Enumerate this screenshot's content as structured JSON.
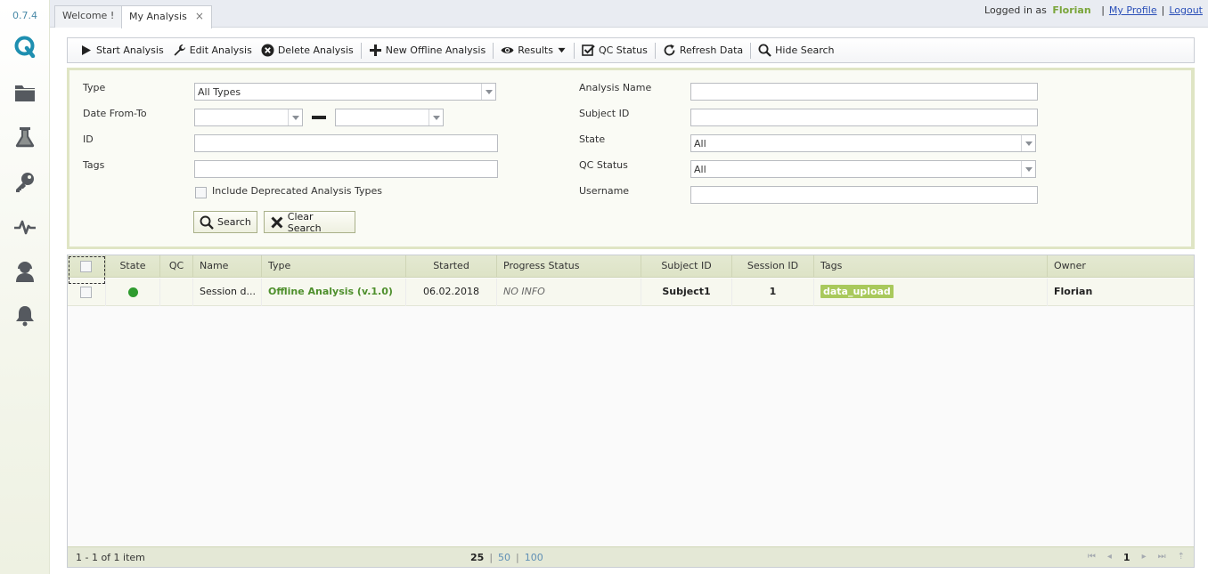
{
  "app": {
    "version": "0.7.4",
    "brand_color": "#1e8fb0",
    "accent_color": "#7aa53a"
  },
  "sidebar": {
    "items": [
      {
        "name": "logo-q-icon"
      },
      {
        "name": "folder-icon"
      },
      {
        "name": "flask-icon"
      },
      {
        "name": "key-icon"
      },
      {
        "name": "heartbeat-icon"
      },
      {
        "name": "user-support-icon"
      },
      {
        "name": "bell-icon"
      }
    ]
  },
  "tabs": [
    {
      "label": "Welcome !"
    },
    {
      "label": "My Analysis",
      "close": "×"
    }
  ],
  "user": {
    "logged_in_prefix": "Logged in as",
    "username": "Florian",
    "separator": "|",
    "profile_link": "My Profile",
    "logout_link": "Logout"
  },
  "toolbar": {
    "start": "Start Analysis",
    "edit": "Edit Analysis",
    "delete": "Delete Analysis",
    "new_offline": "New Offline Analysis",
    "results": "Results",
    "qc_status": "QC Status",
    "refresh": "Refresh Data",
    "hide_search": "Hide Search"
  },
  "search": {
    "type_label": "Type",
    "type_value": "All Types",
    "date_label": "Date From-To",
    "date_from": "",
    "date_to": "",
    "id_label": "ID",
    "id_value": "",
    "tags_label": "Tags",
    "tags_value": "",
    "deprecated_label": "Include Deprecated Analysis Types",
    "analysis_name_label": "Analysis Name",
    "analysis_name_value": "",
    "subject_id_label": "Subject ID",
    "subject_id_value": "",
    "state_label": "State",
    "state_value": "All",
    "qc_status_label": "QC Status",
    "qc_status_value": "All",
    "username_label": "Username",
    "username_value": "",
    "search_button": "Search",
    "clear_button": "Clear Search"
  },
  "grid": {
    "columns": [
      "State",
      "QC",
      "Name",
      "Type",
      "Started",
      "Progress Status",
      "Subject ID",
      "Session ID",
      "Tags",
      "Owner"
    ],
    "rows": [
      {
        "state": "running",
        "state_color": "#2e9b2e",
        "qc": "",
        "name": "Session d...",
        "type": "Offline Analysis (v.1.0)",
        "started": "06.02.2018",
        "progress": "NO INFO",
        "subject_id": "Subject1",
        "session_id": "1",
        "tag": "data_upload",
        "owner": "Florian"
      }
    ]
  },
  "pager": {
    "info": "1 - 1 of 1 item",
    "size_current": "25",
    "size_options": [
      "50",
      "100"
    ],
    "separator": "|",
    "page": "1",
    "nav_first": "⏮",
    "nav_prev": "◂",
    "nav_next": "▸",
    "nav_last": "⏭",
    "nav_refresh": "⇡"
  }
}
